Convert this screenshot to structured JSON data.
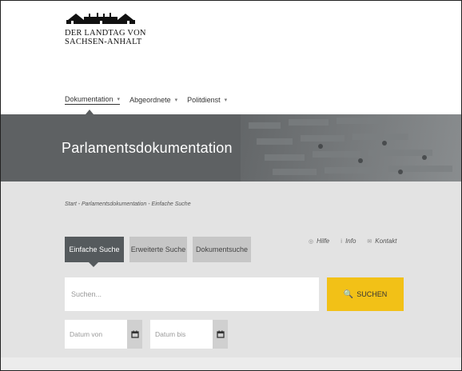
{
  "logo": {
    "line1": "DER LANDTAG VON",
    "line2": "SACHSEN-ANHALT"
  },
  "nav": {
    "items": [
      {
        "label": "Dokumentation"
      },
      {
        "label": "Abgeordnete"
      },
      {
        "label": "Politdienst"
      }
    ]
  },
  "hero": {
    "title": "Parlamentsdokumentation"
  },
  "breadcrumb": "Start - Parlamentsdokumentation - Einfache Suche",
  "tabs": [
    {
      "label": "Einfache Suche"
    },
    {
      "label": "Erweiterte Suche"
    },
    {
      "label": "Dokumentsuche"
    }
  ],
  "links": [
    {
      "label": "Hilfe"
    },
    {
      "label": "Info"
    },
    {
      "label": "Kontakt"
    }
  ],
  "search": {
    "placeholder": "Suchen...",
    "button_label": "SUCHEN"
  },
  "date": {
    "from_placeholder": "Datum von",
    "to_placeholder": "Datum bis"
  },
  "colors": {
    "accent": "#f2c117",
    "hero": "#5e6163",
    "tab_active": "#555a5d",
    "background": "#e3e3e3"
  }
}
